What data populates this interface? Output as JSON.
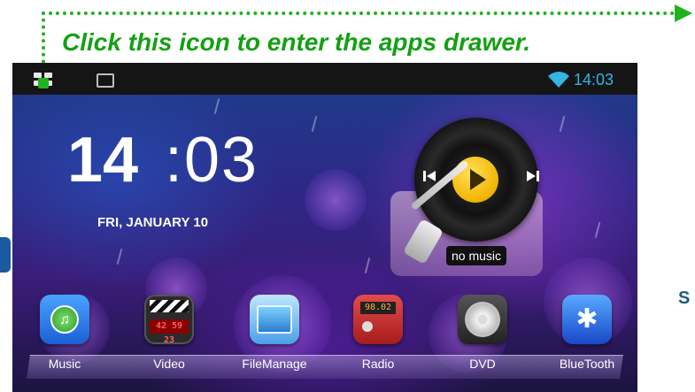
{
  "annotation": {
    "text": "Click this icon to enter the apps drawer.",
    "color": "#1fb31f"
  },
  "statusbar": {
    "left_icons": [
      "apps-drawer-icon",
      "picture-icon"
    ],
    "right_icons": [
      "wifi-icon"
    ],
    "time": "14:03",
    "time_color": "#33b5e5"
  },
  "clock": {
    "hour": "14",
    "minute": ":03",
    "date": "FRI, JANUARY 10"
  },
  "music_widget": {
    "status": "no music",
    "controls": [
      "previous-track-icon",
      "play-icon",
      "next-track-icon"
    ]
  },
  "dock": {
    "apps": [
      {
        "label": "Music",
        "icon": "music-app-icon"
      },
      {
        "label": "Video",
        "icon": "video-app-icon",
        "icon_text": "42 59 23"
      },
      {
        "label": "FileManage",
        "icon": "file-manager-icon"
      },
      {
        "label": "Radio",
        "icon": "radio-app-icon",
        "icon_text": "98.02"
      },
      {
        "label": "DVD",
        "icon": "dvd-app-icon"
      },
      {
        "label": "BlueTooth",
        "icon": "bluetooth-app-icon"
      }
    ]
  },
  "page_edge_text": "S"
}
